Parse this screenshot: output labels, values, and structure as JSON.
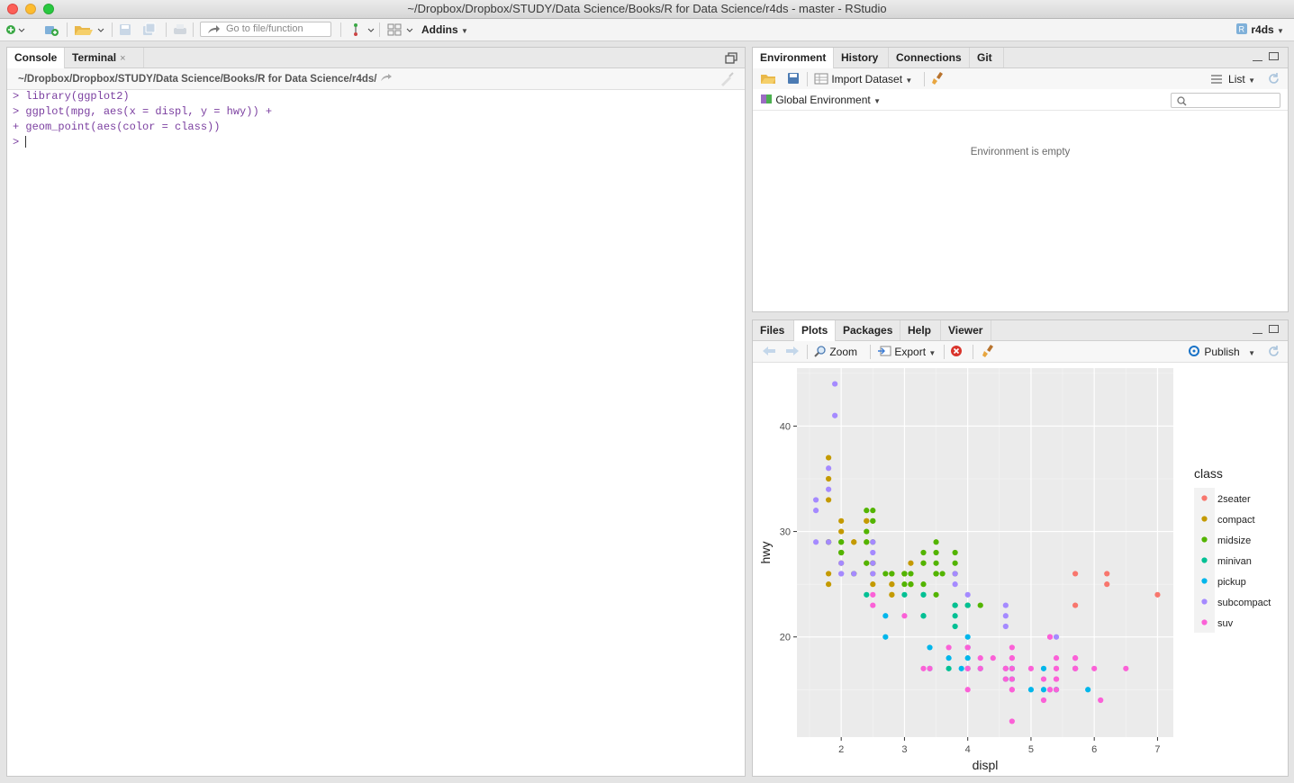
{
  "window": {
    "title": "~/Dropbox/Dropbox/STUDY/Data Science/Books/R for Data Science/r4ds - master - RStudio"
  },
  "toolbar": {
    "goto_placeholder": "Go to file/function",
    "addins_label": "Addins",
    "project_label": "r4ds"
  },
  "console_pane": {
    "tabs": [
      {
        "label": "Console"
      },
      {
        "label": "Terminal"
      }
    ],
    "terminal_close": "×",
    "path": "~/Dropbox/Dropbox/STUDY/Data Science/Books/R for Data Science/r4ds/",
    "lines": [
      {
        "prompt": ">",
        "code": "library(ggplot2)"
      },
      {
        "prompt": ">",
        "code": "ggplot(mpg, aes(x = displ, y = hwy)) +"
      },
      {
        "prompt": "+",
        "code": "geom_point(aes(color = class))"
      },
      {
        "prompt": ">",
        "code": ""
      }
    ]
  },
  "env_pane": {
    "tabs": [
      {
        "label": "Environment"
      },
      {
        "label": "History"
      },
      {
        "label": "Connections"
      },
      {
        "label": "Git"
      }
    ],
    "import_label": "Import Dataset",
    "view_label": "List",
    "scope_label": "Global Environment",
    "empty_message": "Environment is empty"
  },
  "files_pane": {
    "tabs": [
      {
        "label": "Files"
      },
      {
        "label": "Plots"
      },
      {
        "label": "Packages"
      },
      {
        "label": "Help"
      },
      {
        "label": "Viewer"
      }
    ],
    "zoom_label": "Zoom",
    "export_label": "Export",
    "publish_label": "Publish"
  },
  "colors": {
    "panel_bg": "#ebebeb",
    "accent": "#1a73c7"
  },
  "chart_data": {
    "type": "scatter",
    "title": "",
    "xlabel": "displ",
    "ylabel": "hwy",
    "xlim": [
      1.3,
      7.25
    ],
    "ylim": [
      10.5,
      45.5
    ],
    "xticks": [
      2,
      3,
      4,
      5,
      6,
      7
    ],
    "yticks": [
      20,
      30,
      40
    ],
    "grid": true,
    "legend": {
      "title": "class",
      "position": "right"
    },
    "series": [
      {
        "name": "2seater",
        "color": "#F8766D",
        "points": [
          [
            5.7,
            26
          ],
          [
            5.7,
            23
          ],
          [
            6.2,
            26
          ],
          [
            6.2,
            25
          ],
          [
            7.0,
            24
          ]
        ]
      },
      {
        "name": "compact",
        "color": "#C49A00",
        "points": [
          [
            1.8,
            29
          ],
          [
            1.8,
            29
          ],
          [
            2.0,
            31
          ],
          [
            2.0,
            30
          ],
          [
            2.8,
            26
          ],
          [
            2.8,
            26
          ],
          [
            3.1,
            27
          ],
          [
            1.8,
            26
          ],
          [
            1.8,
            25
          ],
          [
            2.0,
            28
          ],
          [
            2.0,
            27
          ],
          [
            2.8,
            25
          ],
          [
            2.8,
            25
          ],
          [
            3.1,
            25
          ],
          [
            3.1,
            25
          ],
          [
            2.2,
            26
          ],
          [
            2.2,
            29
          ],
          [
            2.4,
            27
          ],
          [
            2.4,
            31
          ],
          [
            3.0,
            26
          ],
          [
            3.0,
            26
          ],
          [
            3.3,
            27
          ],
          [
            1.8,
            33
          ],
          [
            1.8,
            35
          ],
          [
            1.8,
            37
          ],
          [
            2.5,
            27
          ],
          [
            2.5,
            25
          ],
          [
            2.5,
            26
          ],
          [
            2.5,
            27
          ],
          [
            2.8,
            24
          ],
          [
            2.8,
            24
          ],
          [
            2.4,
            31
          ],
          [
            2.4,
            29
          ],
          [
            2.2,
            29
          ]
        ]
      },
      {
        "name": "midsize",
        "color": "#53B400",
        "points": [
          [
            2.4,
            27
          ],
          [
            2.4,
            30
          ],
          [
            3.1,
            26
          ],
          [
            3.5,
            29
          ],
          [
            3.6,
            26
          ],
          [
            2.4,
            32
          ],
          [
            3.3,
            27
          ],
          [
            3.8,
            28
          ],
          [
            3.8,
            26
          ],
          [
            2.5,
            29
          ],
          [
            2.5,
            32
          ],
          [
            3.0,
            26
          ],
          [
            3.3,
            25
          ],
          [
            3.5,
            28
          ],
          [
            3.5,
            27
          ],
          [
            3.8,
            27
          ],
          [
            2.0,
            28
          ],
          [
            2.0,
            29
          ],
          [
            3.5,
            26
          ],
          [
            3.5,
            26
          ],
          [
            2.5,
            27
          ],
          [
            2.7,
            26
          ],
          [
            3.5,
            26
          ],
          [
            3.0,
            26
          ],
          [
            2.2,
            26
          ],
          [
            2.4,
            29
          ],
          [
            3.0,
            25
          ],
          [
            3.3,
            28
          ],
          [
            4.2,
            23
          ],
          [
            1.8,
            29
          ],
          [
            2.0,
            29
          ],
          [
            2.0,
            28
          ],
          [
            2.8,
            26
          ],
          [
            3.1,
            25
          ],
          [
            3.5,
            24
          ],
          [
            2.5,
            31
          ],
          [
            2.5,
            31
          ],
          [
            3.5,
            26
          ],
          [
            3.8,
            23
          ],
          [
            4.0,
            23
          ]
        ]
      },
      {
        "name": "minivan",
        "color": "#00C094",
        "points": [
          [
            2.4,
            24
          ],
          [
            3.0,
            24
          ],
          [
            3.3,
            22
          ],
          [
            3.3,
            24
          ],
          [
            3.3,
            24
          ],
          [
            3.3,
            22
          ],
          [
            3.8,
            21
          ],
          [
            3.8,
            22
          ],
          [
            3.8,
            23
          ],
          [
            4.0,
            23
          ],
          [
            3.7,
            17
          ]
        ]
      },
      {
        "name": "pickup",
        "color": "#00B6EB",
        "points": [
          [
            2.7,
            20
          ],
          [
            2.7,
            22
          ],
          [
            3.4,
            19
          ],
          [
            3.4,
            17
          ],
          [
            4.0,
            20
          ],
          [
            4.0,
            17
          ],
          [
            4.7,
            17
          ],
          [
            4.7,
            16
          ],
          [
            4.7,
            17
          ],
          [
            4.7,
            16
          ],
          [
            5.2,
            17
          ],
          [
            5.2,
            15
          ],
          [
            5.7,
            17
          ],
          [
            5.9,
            15
          ],
          [
            4.2,
            17
          ],
          [
            4.6,
            17
          ],
          [
            5.4,
            15
          ],
          [
            5.4,
            15
          ],
          [
            3.7,
            18
          ],
          [
            3.9,
            17
          ],
          [
            4.0,
            19
          ],
          [
            4.0,
            18
          ],
          [
            4.6,
            16
          ],
          [
            5.0,
            15
          ]
        ]
      },
      {
        "name": "subcompact",
        "color": "#A58AFF",
        "points": [
          [
            1.9,
            44
          ],
          [
            1.9,
            41
          ],
          [
            1.8,
            36
          ],
          [
            1.8,
            34
          ],
          [
            1.6,
            33
          ],
          [
            1.6,
            32
          ],
          [
            1.6,
            29
          ],
          [
            1.8,
            29
          ],
          [
            2.0,
            26
          ],
          [
            2.0,
            27
          ],
          [
            2.0,
            26
          ],
          [
            2.5,
            26
          ],
          [
            2.5,
            28
          ],
          [
            2.5,
            29
          ],
          [
            2.2,
            26
          ],
          [
            3.8,
            26
          ],
          [
            3.8,
            25
          ],
          [
            4.0,
            24
          ],
          [
            4.6,
            23
          ],
          [
            4.6,
            22
          ],
          [
            5.4,
            20
          ],
          [
            4.6,
            21
          ],
          [
            2.5,
            27
          ]
        ]
      },
      {
        "name": "suv",
        "color": "#FB61D7",
        "points": [
          [
            5.3,
            20
          ],
          [
            5.3,
            15
          ],
          [
            5.3,
            20
          ],
          [
            5.7,
            17
          ],
          [
            6.0,
            17
          ],
          [
            5.7,
            18
          ],
          [
            5.7,
            17
          ],
          [
            6.5,
            17
          ],
          [
            4.7,
            19
          ],
          [
            4.7,
            18
          ],
          [
            4.7,
            17
          ],
          [
            4.7,
            15
          ],
          [
            4.7,
            12
          ],
          [
            5.7,
            17
          ],
          [
            6.1,
            14
          ],
          [
            4.0,
            19
          ],
          [
            4.0,
            19
          ],
          [
            4.6,
            17
          ],
          [
            5.0,
            17
          ],
          [
            4.2,
            18
          ],
          [
            4.2,
            17
          ],
          [
            4.6,
            16
          ],
          [
            4.6,
            17
          ],
          [
            5.4,
            16
          ],
          [
            5.4,
            17
          ],
          [
            4.0,
            17
          ],
          [
            4.0,
            15
          ],
          [
            4.0,
            17
          ],
          [
            4.4,
            18
          ],
          [
            3.3,
            17
          ],
          [
            3.7,
            19
          ],
          [
            4.7,
            18
          ],
          [
            4.7,
            15
          ],
          [
            5.7,
            18
          ],
          [
            5.4,
            17
          ],
          [
            5.4,
            15
          ],
          [
            5.4,
            16
          ],
          [
            5.4,
            18
          ],
          [
            3.0,
            22
          ],
          [
            2.5,
            24
          ],
          [
            2.5,
            23
          ],
          [
            5.2,
            16
          ],
          [
            5.2,
            14
          ],
          [
            5.3,
            15
          ],
          [
            4.7,
            16
          ],
          [
            3.4,
            17
          ]
        ]
      }
    ]
  }
}
